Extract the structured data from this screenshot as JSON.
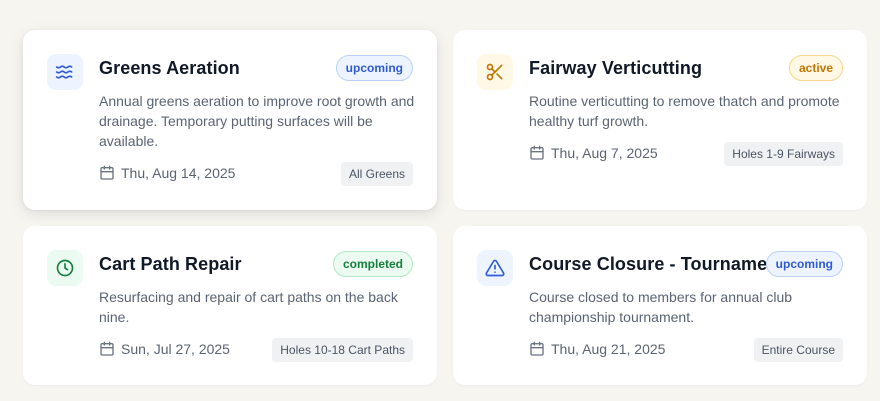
{
  "cards": [
    {
      "title": "Greens Aeration",
      "status": "upcoming",
      "description": "Annual greens aeration to improve root growth and drainage. Temporary putting surfaces will be available.",
      "date": "Thu, Aug 14, 2025",
      "location": "All Greens",
      "icon": "waves-icon",
      "icon_bg": "#eef4ff",
      "icon_color": "#2f5bd3"
    },
    {
      "title": "Fairway Verticutting",
      "status": "active",
      "description": "Routine verticutting to remove thatch and promote healthy turf growth.",
      "date": "Thu, Aug 7, 2025",
      "location": "Holes 1-9 Fairways",
      "icon": "scissors-icon",
      "icon_bg": "#fff8e6",
      "icon_color": "#c27803"
    },
    {
      "title": "Cart Path Repair",
      "status": "completed",
      "description": "Resurfacing and repair of cart paths on the back nine.",
      "date": "Sun, Jul 27, 2025",
      "location": "Holes 10-18 Cart Paths",
      "icon": "clock-icon",
      "icon_bg": "#ecfbf1",
      "icon_color": "#15803d"
    },
    {
      "title": "Course Closure - Tournament",
      "status": "upcoming",
      "description": "Course closed to members for annual club championship tournament.",
      "date": "Thu, Aug 21, 2025",
      "location": "Entire Course",
      "icon": "alert-triangle-icon",
      "icon_bg": "#eef4ff",
      "icon_color": "#2f5bd3"
    }
  ]
}
